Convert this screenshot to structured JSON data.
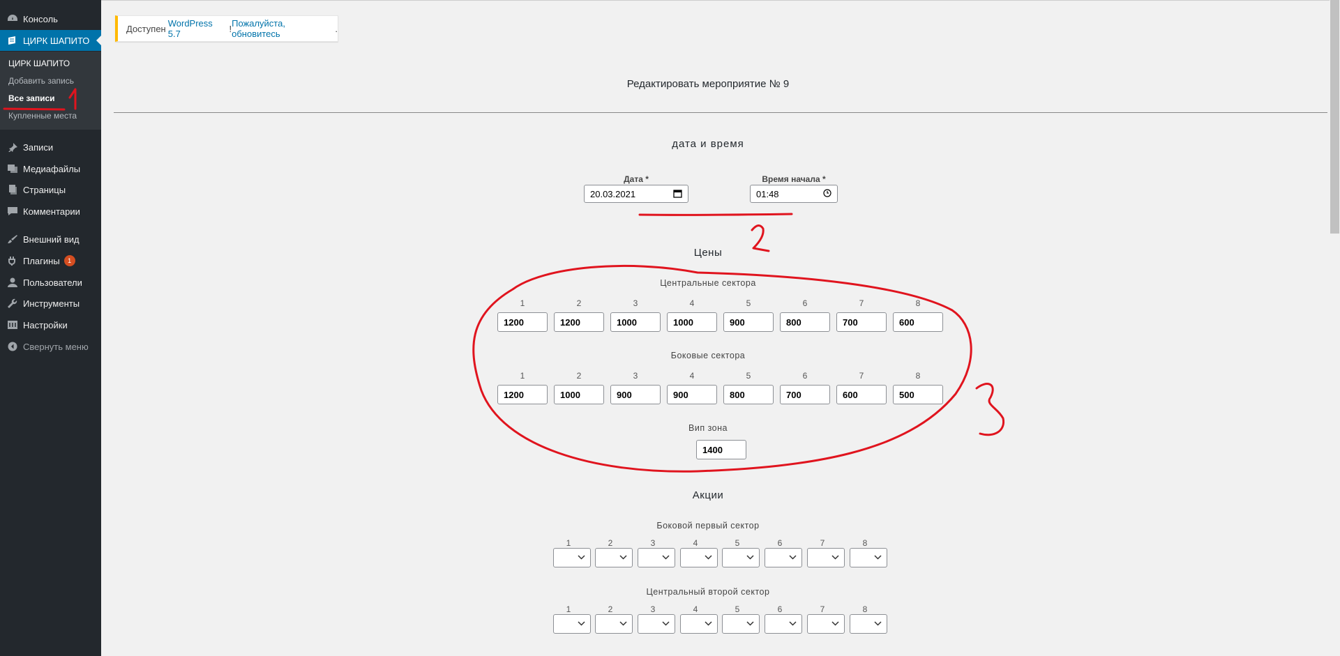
{
  "sidebar": {
    "items": [
      {
        "label": "Консоль",
        "icon": "dashboard-icon",
        "active": false
      },
      {
        "label": "ЦИРК ШАПИТО",
        "icon": "circus-icon",
        "active": true
      },
      {
        "label": "Записи",
        "icon": "pin-icon",
        "active": false
      },
      {
        "label": "Медиафайлы",
        "icon": "media-icon",
        "active": false
      },
      {
        "label": "Страницы",
        "icon": "pages-icon",
        "active": false
      },
      {
        "label": "Комментарии",
        "icon": "comments-icon",
        "active": false
      },
      {
        "label": "Внешний вид",
        "icon": "brush-icon",
        "active": false
      },
      {
        "label": "Плагины",
        "icon": "plugins-icon",
        "active": false,
        "badge": "1"
      },
      {
        "label": "Пользователи",
        "icon": "users-icon",
        "active": false
      },
      {
        "label": "Инструменты",
        "icon": "wrench-icon",
        "active": false
      },
      {
        "label": "Настройки",
        "icon": "settings-icon",
        "active": false
      }
    ],
    "submenu": [
      {
        "label": "ЦИРК ШАПИТО",
        "current": false
      },
      {
        "label": "Добавить запись",
        "current": false
      },
      {
        "label": "Все записи",
        "current": true
      },
      {
        "label": "Купленные места",
        "current": false
      }
    ],
    "collapse_label": "Свернуть меню"
  },
  "notice": {
    "prefix": "Доступен",
    "link": "WordPress 5.7",
    "middle": "! ",
    "link2": "Пожалуйста, обновитесь",
    "suffix": "."
  },
  "page_title": "Редактировать мероприятие № 9",
  "datetime": {
    "title": "дата и время",
    "date_label": "Дата *",
    "date_value": "20.03.2021",
    "time_label": "Время начала *",
    "time_value": "01:48"
  },
  "prices": {
    "title": "Цены",
    "central": {
      "title": "Центральные сектора",
      "labels": [
        "1",
        "2",
        "3",
        "4",
        "5",
        "6",
        "7",
        "8"
      ],
      "values": [
        "1200",
        "1200",
        "1000",
        "1000",
        "900",
        "800",
        "700",
        "600"
      ]
    },
    "side": {
      "title": "Боковые сектора",
      "labels": [
        "1",
        "2",
        "3",
        "4",
        "5",
        "6",
        "7",
        "8"
      ],
      "values": [
        "1200",
        "1000",
        "900",
        "900",
        "800",
        "700",
        "600",
        "500"
      ]
    },
    "vip": {
      "title": "Вип зона",
      "value": "1400"
    }
  },
  "promos": {
    "title": "Акции",
    "groups": [
      {
        "title": "Боковой первый сектор",
        "labels": [
          "1",
          "2",
          "3",
          "4",
          "5",
          "6",
          "7",
          "8"
        ]
      },
      {
        "title": "Центральный второй сектор",
        "labels": [
          "1",
          "2",
          "3",
          "4",
          "5",
          "6",
          "7",
          "8"
        ]
      }
    ]
  },
  "annotations": {
    "n1": "1",
    "n2": "2",
    "n3": "3",
    "color": "#e0141e"
  }
}
